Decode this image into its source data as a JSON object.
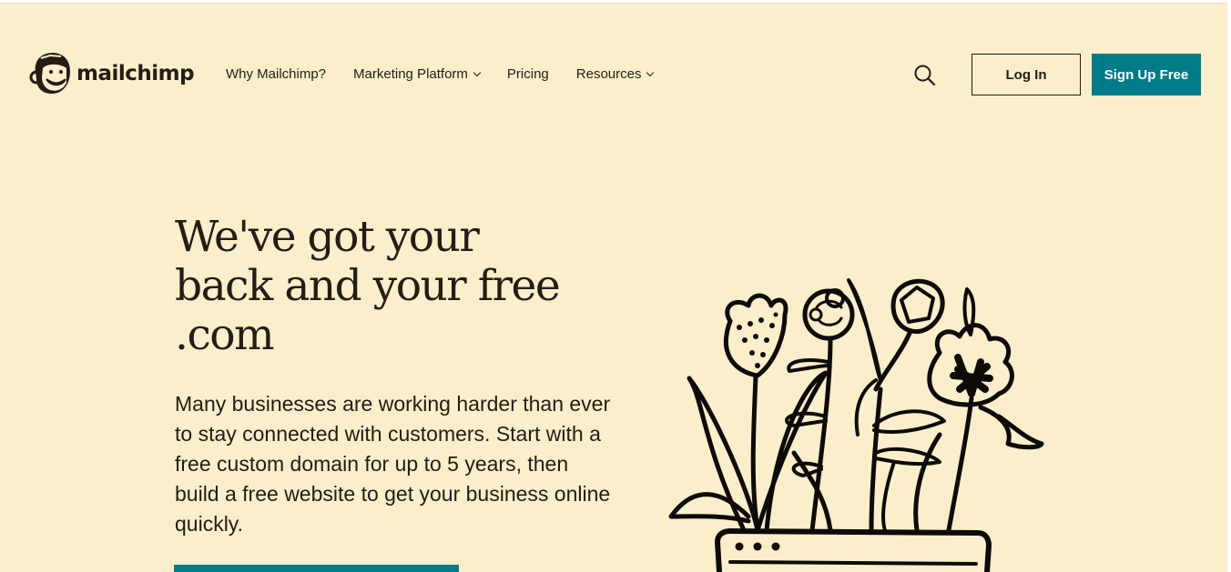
{
  "brand": {
    "name": "mailchimp",
    "logo_icon": "freddie-monkey-icon"
  },
  "nav": {
    "items": [
      {
        "label": "Why Mailchimp?",
        "has_dropdown": false
      },
      {
        "label": "Marketing Platform",
        "has_dropdown": true
      },
      {
        "label": "Pricing",
        "has_dropdown": false
      },
      {
        "label": "Resources",
        "has_dropdown": true
      }
    ],
    "search_icon": "search-icon",
    "login_label": "Log In",
    "signup_label": "Sign Up Free"
  },
  "hero": {
    "title_lines": [
      "We've got your",
      "back and your free",
      ".com"
    ],
    "body": "Many businesses are working harder than ever to stay connected with customers. Start with a free custom domain for up to 5 years, then build a free website to get your business online quickly.",
    "illustration": "flowers-in-browser-pot-illustration"
  },
  "colors": {
    "background": "#fbeecb",
    "accent": "#007c89",
    "text": "#241c15"
  }
}
